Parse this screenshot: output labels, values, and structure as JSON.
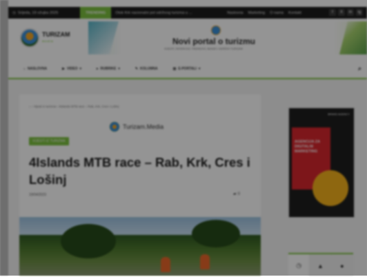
{
  "topbar": {
    "date": "Srijeda, 19 ožujka 2025",
    "trending_label": "TRENDING",
    "ticker": "Otok Krk nacionalni pol održivog turizma u ...",
    "links": [
      "Naslovna",
      "Marketing",
      "O nama",
      "Kontakt"
    ],
    "social": [
      "f",
      "X",
      "in",
      "ig"
    ]
  },
  "header": {
    "logo_name": "TURIZAM",
    "logo_sub": "media",
    "banner_title": "Novi portal o turizmu",
    "banner_sub": "VIJESTI, INTERVJUI, TRENDOVI, BIZNIS I ODRŽIVI TURIZAM"
  },
  "nav": {
    "items": [
      {
        "icon": "home-icon",
        "label": "NASLOVNA",
        "has_dropdown": false
      },
      {
        "icon": "video-icon",
        "label": "VIDEO",
        "has_dropdown": true
      },
      {
        "icon": "rubrike-icon",
        "label": "RUBRIKE",
        "has_dropdown": true
      },
      {
        "icon": "pen-icon",
        "label": "KOLUMNA",
        "has_dropdown": false
      },
      {
        "icon": "portals-icon",
        "label": "E-PORTALI",
        "has_dropdown": true
      }
    ]
  },
  "article": {
    "breadcrumb": [
      "Vijesti iz turizma",
      "4islands MTB race – Rab, Krk, Cres i Lošinj"
    ],
    "brand": "Turizam.Media",
    "category": "VIJESTI IZ TURIZMA",
    "title": "4Islands MTB race – Rab, Krk, Cres i Lošinj",
    "date": "19/04/2023",
    "comment_count": "0"
  },
  "sidebar": {
    "ad_text": "AGENCIJA ZA DIGITALNI MARKETING",
    "ad_logo": "BRAND AGENCY",
    "tabs": [
      "clock-icon",
      "flame-icon",
      "comment-icon"
    ]
  },
  "colors": {
    "accent": "#7cc03f",
    "topbar": "#1d1d1d",
    "ad_red": "#d8262d"
  }
}
